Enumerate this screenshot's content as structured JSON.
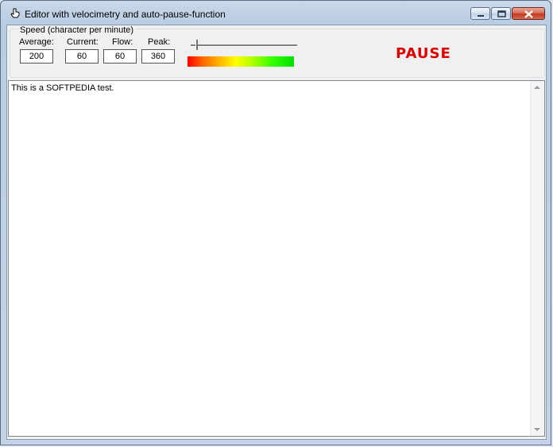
{
  "window": {
    "title": "Editor with velocimetry and auto-pause-function",
    "icons": {
      "app": "hand-pointer-icon",
      "minimize": "minimize-icon",
      "maximize": "maximize-icon",
      "close": "close-icon"
    }
  },
  "speed": {
    "group_label": "Speed (character per minute)",
    "average_label": "Average:",
    "average_value": "200",
    "current_label": "Current:",
    "current_value": "60",
    "flow_label": "Flow:",
    "flow_value": "60",
    "peak_label": "Peak:",
    "peak_value": "360",
    "status": "PAUSE",
    "status_color": "#e00000"
  },
  "editor": {
    "text": "This is a SOFTPEDIA test."
  }
}
